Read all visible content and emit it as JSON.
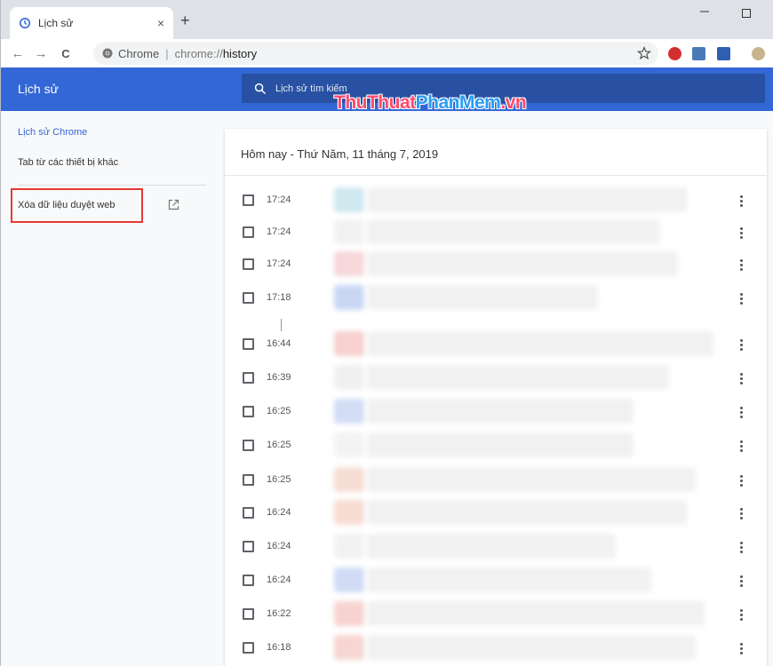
{
  "browser": {
    "tab_title": "Lịch sử",
    "tab_close": "×",
    "new_tab": "+",
    "back": "←",
    "forward": "→",
    "reload": "C",
    "site_chip": "Chrome",
    "url_scheme": "chrome://",
    "url_host": "history"
  },
  "header": {
    "title": "Lịch sử",
    "search_placeholder": "Lịch sử tìm kiếm",
    "watermark_a": "ThuThuat",
    "watermark_b": "PhanMem",
    "watermark_c": ".vn"
  },
  "sidebar": {
    "items": [
      {
        "label": "Lịch sử Chrome",
        "active": true
      },
      {
        "label": "Tab từ các thiết bị khác",
        "active": false
      },
      {
        "label": "Xóa dữ liệu duyệt web",
        "active": false
      }
    ]
  },
  "history": {
    "date_heading": "Hôm nay - Thứ Năm, 11 tháng 7, 2019",
    "entries": [
      {
        "time": "17:24"
      },
      {
        "time": "17:24"
      },
      {
        "time": "17:24"
      },
      {
        "time": "17:18"
      },
      {
        "time": "16:44"
      },
      {
        "time": "16:39"
      },
      {
        "time": "16:25"
      },
      {
        "time": "16:25"
      },
      {
        "time": "16:25"
      },
      {
        "time": "16:24"
      },
      {
        "time": "16:24"
      },
      {
        "time": "16:24"
      },
      {
        "time": "16:22"
      },
      {
        "time": "16:18"
      }
    ]
  },
  "colors": {
    "header_bg": "#3367d6",
    "search_bg": "#2851a3",
    "highlight_border": "#e53935",
    "active_link": "#3367d6"
  }
}
